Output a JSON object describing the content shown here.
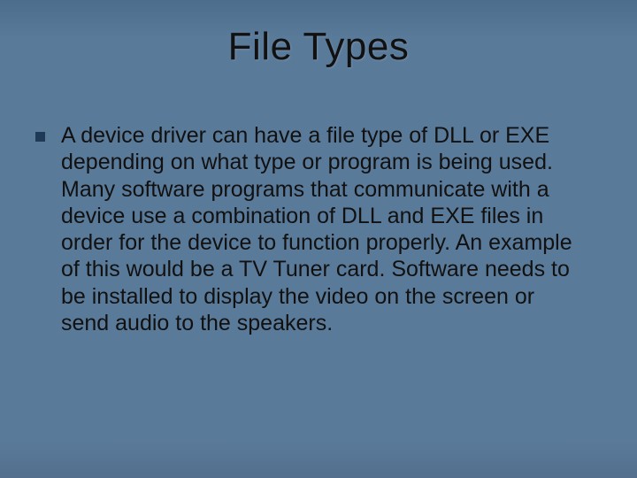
{
  "slide": {
    "title": "File Types",
    "bullets": [
      {
        "text": "A device driver can have a file type of DLL or EXE depending on what type or program is being used. Many software programs that communicate with a device use a combination of DLL and EXE files in order for the device to function properly. An example of this would be a TV Tuner card. Software needs to be installed to display the video on the screen or send audio to the speakers."
      }
    ]
  },
  "theme": {
    "background": "#5a7a9a",
    "bullet_color": "#1f3a56",
    "text_color": "#111111"
  }
}
